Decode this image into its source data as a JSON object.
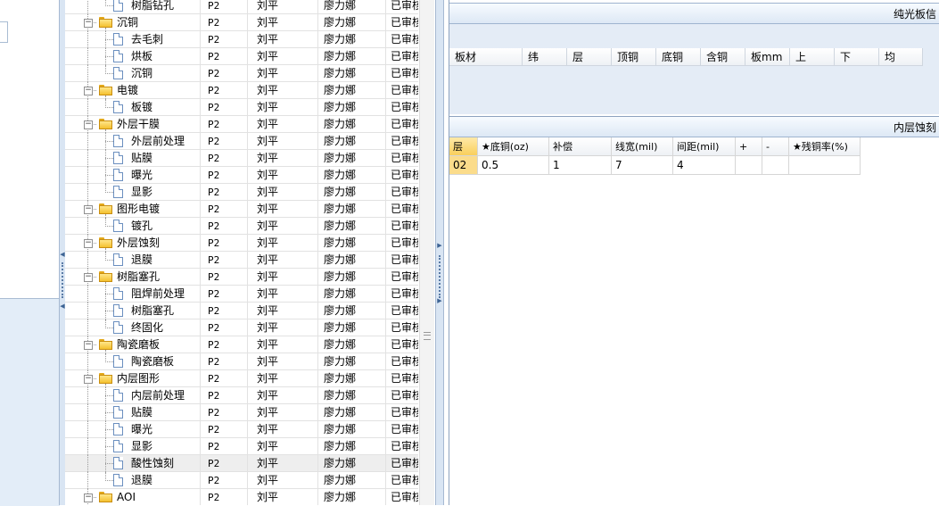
{
  "tree": {
    "rows": [
      {
        "name": "树脂钻孔",
        "level": 1,
        "kind": "doc",
        "proc": "P2",
        "operator": "刘平",
        "checker": "廖力娜",
        "status": "已审核"
      },
      {
        "name": "沉铜",
        "level": 0,
        "kind": "folder",
        "proc": "P2",
        "operator": "刘平",
        "checker": "廖力娜",
        "status": "已审核"
      },
      {
        "name": "去毛刺",
        "level": 1,
        "kind": "doc",
        "proc": "P2",
        "operator": "刘平",
        "checker": "廖力娜",
        "status": "已审核"
      },
      {
        "name": "烘板",
        "level": 1,
        "kind": "doc",
        "proc": "P2",
        "operator": "刘平",
        "checker": "廖力娜",
        "status": "已审核"
      },
      {
        "name": "沉铜",
        "level": 1,
        "kind": "doc",
        "proc": "P2",
        "operator": "刘平",
        "checker": "廖力娜",
        "status": "已审核"
      },
      {
        "name": "电镀",
        "level": 0,
        "kind": "folder",
        "proc": "P2",
        "operator": "刘平",
        "checker": "廖力娜",
        "status": "已审核"
      },
      {
        "name": "板镀",
        "level": 1,
        "kind": "doc",
        "proc": "P2",
        "operator": "刘平",
        "checker": "廖力娜",
        "status": "已审核"
      },
      {
        "name": "外层干膜",
        "level": 0,
        "kind": "folder",
        "proc": "P2",
        "operator": "刘平",
        "checker": "廖力娜",
        "status": "已审核"
      },
      {
        "name": "外层前处理",
        "level": 1,
        "kind": "doc",
        "proc": "P2",
        "operator": "刘平",
        "checker": "廖力娜",
        "status": "已审核"
      },
      {
        "name": "贴膜",
        "level": 1,
        "kind": "doc",
        "proc": "P2",
        "operator": "刘平",
        "checker": "廖力娜",
        "status": "已审核"
      },
      {
        "name": "曝光",
        "level": 1,
        "kind": "doc",
        "proc": "P2",
        "operator": "刘平",
        "checker": "廖力娜",
        "status": "已审核"
      },
      {
        "name": "显影",
        "level": 1,
        "kind": "doc",
        "proc": "P2",
        "operator": "刘平",
        "checker": "廖力娜",
        "status": "已审核"
      },
      {
        "name": "图形电镀",
        "level": 0,
        "kind": "folder",
        "proc": "P2",
        "operator": "刘平",
        "checker": "廖力娜",
        "status": "已审核"
      },
      {
        "name": "镀孔",
        "level": 1,
        "kind": "doc",
        "proc": "P2",
        "operator": "刘平",
        "checker": "廖力娜",
        "status": "已审核"
      },
      {
        "name": "外层蚀刻",
        "level": 0,
        "kind": "folder",
        "proc": "P2",
        "operator": "刘平",
        "checker": "廖力娜",
        "status": "已审核"
      },
      {
        "name": "退膜",
        "level": 1,
        "kind": "doc",
        "proc": "P2",
        "operator": "刘平",
        "checker": "廖力娜",
        "status": "已审核"
      },
      {
        "name": "树脂塞孔",
        "level": 0,
        "kind": "folder",
        "proc": "P2",
        "operator": "刘平",
        "checker": "廖力娜",
        "status": "已审核"
      },
      {
        "name": "阻焊前处理",
        "level": 1,
        "kind": "doc",
        "proc": "P2",
        "operator": "刘平",
        "checker": "廖力娜",
        "status": "已审核"
      },
      {
        "name": "树脂塞孔",
        "level": 1,
        "kind": "doc",
        "proc": "P2",
        "operator": "刘平",
        "checker": "廖力娜",
        "status": "已审核"
      },
      {
        "name": "终固化",
        "level": 1,
        "kind": "doc",
        "proc": "P2",
        "operator": "刘平",
        "checker": "廖力娜",
        "status": "已审核"
      },
      {
        "name": "陶瓷磨板",
        "level": 0,
        "kind": "folder",
        "proc": "P2",
        "operator": "刘平",
        "checker": "廖力娜",
        "status": "已审核"
      },
      {
        "name": "陶瓷磨板",
        "level": 1,
        "kind": "doc",
        "proc": "P2",
        "operator": "刘平",
        "checker": "廖力娜",
        "status": "已审核"
      },
      {
        "name": "内层图形",
        "level": 0,
        "kind": "folder",
        "proc": "P2",
        "operator": "刘平",
        "checker": "廖力娜",
        "status": "已审核"
      },
      {
        "name": "内层前处理",
        "level": 1,
        "kind": "doc",
        "proc": "P2",
        "operator": "刘平",
        "checker": "廖力娜",
        "status": "已审核"
      },
      {
        "name": "贴膜",
        "level": 1,
        "kind": "doc",
        "proc": "P2",
        "operator": "刘平",
        "checker": "廖力娜",
        "status": "已审核"
      },
      {
        "name": "曝光",
        "level": 1,
        "kind": "doc",
        "proc": "P2",
        "operator": "刘平",
        "checker": "廖力娜",
        "status": "已审核"
      },
      {
        "name": "显影",
        "level": 1,
        "kind": "doc",
        "proc": "P2",
        "operator": "刘平",
        "checker": "廖力娜",
        "status": "已审核"
      },
      {
        "name": "酸性蚀刻",
        "level": 1,
        "kind": "doc",
        "proc": "P2",
        "operator": "刘平",
        "checker": "廖力娜",
        "status": "已审核",
        "selected": true
      },
      {
        "name": "退膜",
        "level": 1,
        "kind": "doc",
        "proc": "P2",
        "operator": "刘平",
        "checker": "廖力娜",
        "status": "已审核"
      },
      {
        "name": "AOI",
        "level": 0,
        "kind": "folder",
        "proc": "P2",
        "operator": "刘平",
        "checker": "廖力娜",
        "status": "已审核"
      }
    ]
  },
  "panel1": {
    "title": "纯光板信",
    "columns": [
      "板材",
      "纬",
      "层",
      "顶铜",
      "底铜",
      "含铜",
      "板mm",
      "上",
      "下",
      "均"
    ]
  },
  "panel2": {
    "title": "内层蚀刻",
    "columns": [
      "层",
      "★底铜(oz)",
      "补偿",
      "线宽(mil)",
      "间距(mil)",
      "+",
      "-",
      "★残铜率(%)"
    ],
    "rows": [
      [
        "02",
        "0.5",
        "1",
        "7",
        "4",
        "",
        "",
        ""
      ]
    ]
  },
  "colors": {
    "header_gradient_bottom": "#dde8f5",
    "pane_fill": "#e4ecf6",
    "layer_highlight": "#fbdc8b",
    "selected_row": "#eeeeee"
  }
}
